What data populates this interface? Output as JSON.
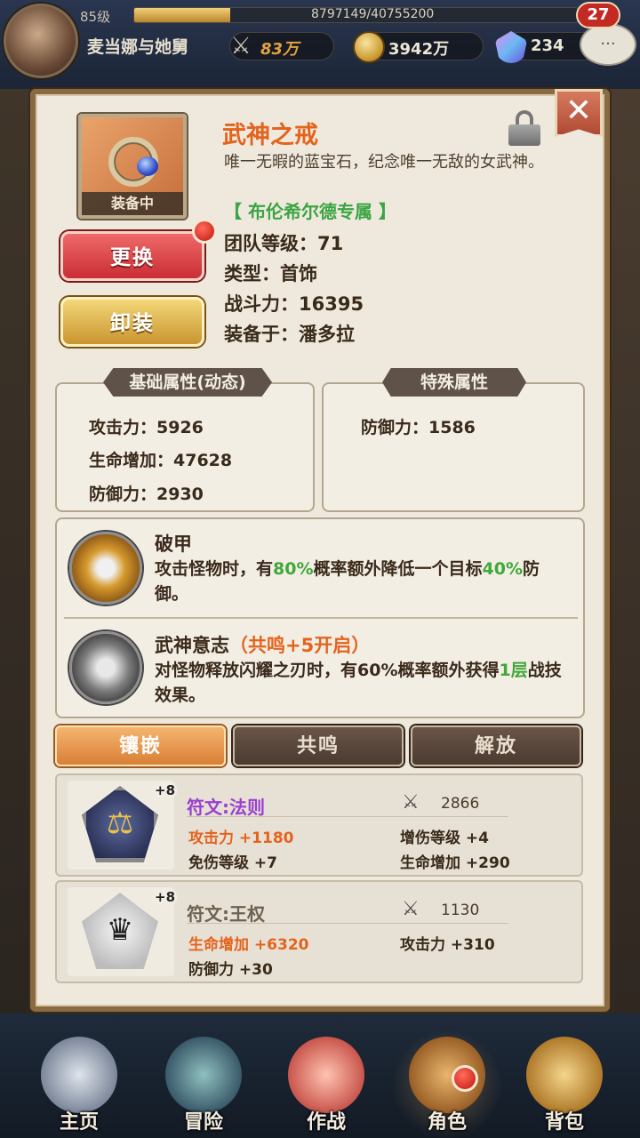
{
  "player": {
    "level": "85级",
    "xp": "8797149/40755200",
    "xp_fraction": 0.216,
    "name": "麦当娜与她舅",
    "power": "83万",
    "gold": "3942万",
    "gems": "234",
    "notifications": "27"
  },
  "item": {
    "name": "武神之戒",
    "description": "唯一无暇的蓝宝石，纪念唯一无敌的女武神。",
    "exclusive": "【 布伦希尔德专属 】",
    "equipped_tag": "装备中",
    "team_level": "团队等级：71",
    "type": "类型：首饰",
    "power": "战斗力：16395",
    "equipped_on": "装备于：潘多拉"
  },
  "buttons": {
    "replace": "更换",
    "unequip": "卸装",
    "close": "✕"
  },
  "basic_attrs": {
    "title": "基础属性(动态)",
    "items": [
      "攻击力：5926",
      "生命增加：47628",
      "防御力：2930"
    ]
  },
  "special_attrs": {
    "title": "特殊属性",
    "items": [
      "防御力：1586"
    ]
  },
  "skills": [
    {
      "name": "破甲",
      "suffix": "",
      "desc_parts": [
        "攻击怪物时，有",
        "80%",
        "概率额外降低一个目标",
        "40%",
        "防御。"
      ]
    },
    {
      "name": "武神意志",
      "suffix": "（共鸣+5开启）",
      "desc_parts": [
        "对怪物释放闪耀之刃时，有60%概率额外获得",
        "1层",
        "战技效果。"
      ]
    }
  ],
  "tabs": [
    "镶嵌",
    "共鸣",
    "解放"
  ],
  "runes": [
    {
      "level": "+8",
      "name": "符文:法则",
      "power": "2866",
      "stats": [
        "攻击力 +1180",
        "增伤等级 +4",
        "免伤等级 +7",
        "生命增加 +290"
      ]
    },
    {
      "level": "+8",
      "name": "符文:王权",
      "power": "1130",
      "stats": [
        "生命增加 +6320",
        "攻击力 +310",
        "防御力 +30"
      ]
    }
  ],
  "nav": [
    "主页",
    "冒险",
    "作战",
    "角色",
    "背包"
  ],
  "icons": {
    "swords": "⚔",
    "balance": "⚖",
    "crown": "♛",
    "chat": "···"
  },
  "colors": {
    "item_name": "#e4631d",
    "exclusive": "#3ba544",
    "highlight_green": "#3fa83a",
    "rune_purple": "#9a3fd0"
  }
}
